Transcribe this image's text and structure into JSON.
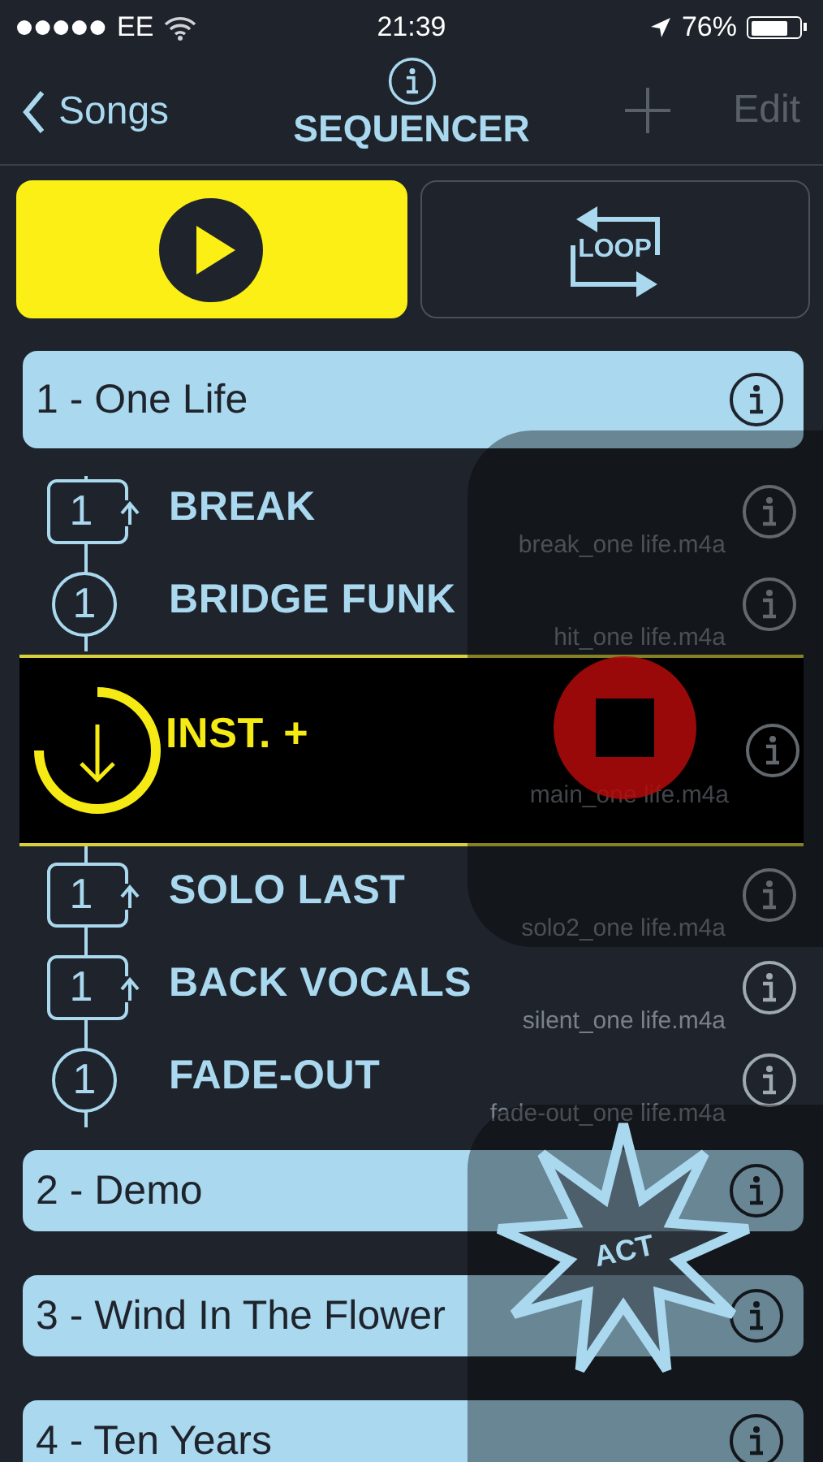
{
  "status_bar": {
    "carrier": "EE",
    "time": "21:39",
    "battery": "76%"
  },
  "nav": {
    "back": "Songs",
    "title": "SEQUENCER",
    "add": {
      "disabled": true
    },
    "edit": {
      "label": "Edit",
      "disabled": true
    }
  },
  "transport": {
    "play": {
      "on": true
    },
    "loop": {
      "label": "LOOP",
      "on": false
    }
  },
  "songs": [
    {
      "title": "1 - One Life",
      "expanded": true,
      "parts": [
        {
          "kind": "loop",
          "count": "1",
          "name": "BREAK",
          "file": "break_one life.m4a",
          "selected": false
        },
        {
          "kind": "once",
          "count": "1",
          "name": "BRIDGE FUNK",
          "file": "hit_one life.m4a",
          "selected": false
        },
        {
          "kind": "pending",
          "name": "INST. +",
          "file": "main_one life.m4a",
          "selected": true
        },
        {
          "kind": "loop",
          "count": "1",
          "name": "SOLO LAST",
          "file": "solo2_one life.m4a",
          "selected": false
        },
        {
          "kind": "loop",
          "count": "1",
          "name": "BACK VOCALS",
          "file": "silent_one life.m4a",
          "selected": false
        },
        {
          "kind": "once",
          "count": "1",
          "name": "FADE-OUT",
          "file": "fade-out_one life.m4a",
          "selected": false
        }
      ]
    },
    {
      "title": "2 - Demo",
      "expanded": false
    },
    {
      "title": "3 - Wind In The Flower",
      "expanded": false
    },
    {
      "title": "4 - Ten Years",
      "expanded": false
    }
  ],
  "floating_controls": {
    "act_label": "ACT"
  }
}
